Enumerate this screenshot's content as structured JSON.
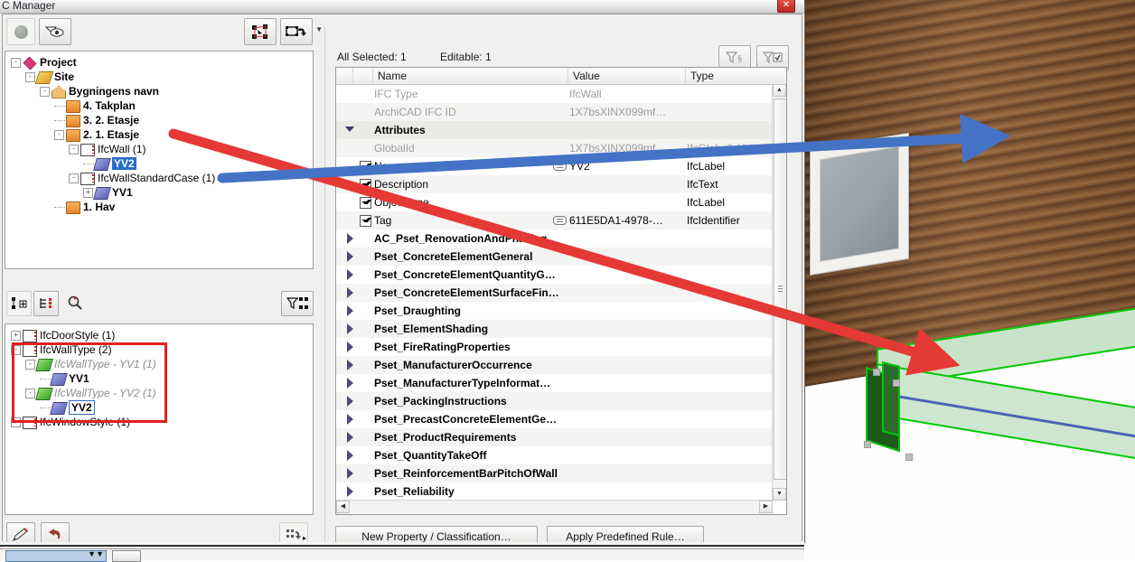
{
  "window": {
    "title": "C Manager",
    "close_label": "✕"
  },
  "viewport": {
    "name": "3d-model-viewport",
    "selected_element_color": "#00c800",
    "wall_material": "wood-cladding",
    "window_count": 1
  },
  "project_tree": {
    "toolbar": {
      "items": [
        {
          "name": "status-indicator",
          "icon": "circle-icon",
          "label": ""
        },
        {
          "name": "show-hide-button",
          "icon": "eye-icon",
          "label": ""
        },
        {
          "name": "select-in-model-button",
          "icon": "select-nodes-icon",
          "label": ""
        },
        {
          "name": "transfer-selection-button",
          "icon": "rect-arrow-icon",
          "label": ""
        }
      ],
      "overflow_label": "▼"
    },
    "rows": [
      {
        "depth": 0,
        "expander": "-",
        "icon": "project-icon",
        "label": "Project",
        "style": "bold"
      },
      {
        "depth": 1,
        "expander": "-",
        "icon": "site-icon",
        "label": "Site",
        "style": "bold"
      },
      {
        "depth": 2,
        "expander": "-",
        "icon": "building-icon",
        "label": "Bygningens navn",
        "style": "bold"
      },
      {
        "depth": 3,
        "expander": "",
        "icon": "story-icon",
        "label": "4. Takplan",
        "style": "bold"
      },
      {
        "depth": 3,
        "expander": "",
        "icon": "story-icon",
        "label": "3. 2. Etasje",
        "style": "bold"
      },
      {
        "depth": 3,
        "expander": "-",
        "icon": "story-icon",
        "label": "2. 1. Etasje",
        "style": "bold"
      },
      {
        "depth": 4,
        "expander": "-",
        "icon": "class-icon",
        "label": "IfcWall (1)",
        "style": "normal"
      },
      {
        "depth": 5,
        "expander": "",
        "icon": "object-blue-icon",
        "label": "YV2",
        "style": "selected"
      },
      {
        "depth": 4,
        "expander": "-",
        "icon": "class-icon",
        "label": "IfcWallStandardCase (1)",
        "style": "normal"
      },
      {
        "depth": 5,
        "expander": "+",
        "icon": "object-blue-icon",
        "label": "YV1",
        "style": "bold"
      },
      {
        "depth": 3,
        "expander": "",
        "icon": "story-icon",
        "label": "1. Hav",
        "style": "bold"
      }
    ]
  },
  "type_tree": {
    "toolbar": {
      "items": [
        {
          "name": "new-type-button",
          "icon": "add-node-icon",
          "label": ""
        },
        {
          "name": "tree-view-button",
          "icon": "tree-list-icon",
          "label": ""
        },
        {
          "name": "search-button",
          "icon": "search-icon",
          "label": ""
        },
        {
          "name": "filter-selection-button",
          "icon": "funnel-nodes-icon",
          "label": ""
        }
      ]
    },
    "rows": [
      {
        "depth": 0,
        "expander": "+",
        "icon": "class-icon",
        "label": "IfcDoorStyle (1)",
        "style": "normal"
      },
      {
        "depth": 0,
        "expander": "-",
        "icon": "class-icon",
        "label": "IfcWallType (2)",
        "style": "normal"
      },
      {
        "depth": 1,
        "expander": "-",
        "icon": "object-green-icon",
        "label": "IfcWallType - YV1 (1)",
        "style": "italic"
      },
      {
        "depth": 2,
        "expander": "",
        "icon": "object-blue-icon",
        "label": "YV1",
        "style": "bold"
      },
      {
        "depth": 1,
        "expander": "-",
        "icon": "object-green-icon",
        "label": "IfcWallType - YV2 (1)",
        "style": "italic"
      },
      {
        "depth": 2,
        "expander": "",
        "icon": "object-blue-icon",
        "label": "YV2",
        "style": "boxed"
      },
      {
        "depth": 0,
        "expander": "+",
        "icon": "class-icon",
        "label": "IfcWindowStyle (1)",
        "style": "normal"
      }
    ],
    "footer": {
      "items": [
        {
          "name": "edit-button",
          "icon": "pencil-icon",
          "label": ""
        },
        {
          "name": "undo-button",
          "icon": "undo-arrow-icon",
          "label": ""
        },
        {
          "name": "options-button",
          "icon": "dots-arrow-icon",
          "label": "▸"
        }
      ]
    }
  },
  "properties": {
    "status_selected": "All Selected: 1",
    "status_editable": "Editable: 1",
    "filter_buttons": [
      {
        "name": "filter-by-paragraph-button",
        "icon": "funnel-paragraph-icon",
        "label": ""
      },
      {
        "name": "filter-by-checked-button",
        "icon": "funnel-check-icon",
        "label": ""
      }
    ],
    "columns": [
      "Name",
      "Value",
      "Type"
    ],
    "rows": [
      {
        "kind": "plain",
        "check": null,
        "name": "IFC Type",
        "value": "IfcWall",
        "type": "",
        "dim": true,
        "link": false
      },
      {
        "kind": "plain",
        "check": null,
        "name": "ArchiCAD IFC ID",
        "value": "1X7bsXINX099mf…",
        "type": "",
        "dim": true,
        "link": false
      },
      {
        "kind": "group",
        "check": null,
        "name": "Attributes",
        "value": "",
        "type": "",
        "dim": false,
        "link": false,
        "expanded": true
      },
      {
        "kind": "plain",
        "check": null,
        "name": "GlobalId",
        "value": "1X7bsXINX099mf…",
        "type": "IfcGloballyUniqueId",
        "dim": true,
        "link": false
      },
      {
        "kind": "checkbox",
        "check": true,
        "name": "Name",
        "value": "YV2",
        "type": "IfcLabel",
        "dim": false,
        "link": true
      },
      {
        "kind": "checkbox",
        "check": true,
        "name": "Description",
        "value": "",
        "type": "IfcText",
        "dim": false,
        "link": false
      },
      {
        "kind": "checkbox",
        "check": true,
        "name": "ObjectType",
        "value": "",
        "type": "IfcLabel",
        "dim": false,
        "link": false
      },
      {
        "kind": "checkbox",
        "check": true,
        "name": "Tag",
        "value": "611E5DA1-4978-…",
        "type": "IfcIdentifier",
        "dim": false,
        "link": true
      },
      {
        "kind": "pset",
        "check": null,
        "name": "AC_Pset_RenovationAndPhasing",
        "value": "",
        "type": "",
        "dim": false,
        "link": false
      },
      {
        "kind": "pset",
        "check": null,
        "name": "Pset_ConcreteElementGeneral",
        "value": "",
        "type": "",
        "dim": false,
        "link": false
      },
      {
        "kind": "pset",
        "check": null,
        "name": "Pset_ConcreteElementQuantityG…",
        "value": "",
        "type": "",
        "dim": false,
        "link": false
      },
      {
        "kind": "pset",
        "check": null,
        "name": "Pset_ConcreteElementSurfaceFin…",
        "value": "",
        "type": "",
        "dim": false,
        "link": false
      },
      {
        "kind": "pset",
        "check": null,
        "name": "Pset_Draughting",
        "value": "",
        "type": "",
        "dim": false,
        "link": false
      },
      {
        "kind": "pset",
        "check": null,
        "name": "Pset_ElementShading",
        "value": "",
        "type": "",
        "dim": false,
        "link": false
      },
      {
        "kind": "pset",
        "check": null,
        "name": "Pset_FireRatingProperties",
        "value": "",
        "type": "",
        "dim": false,
        "link": false
      },
      {
        "kind": "pset",
        "check": null,
        "name": "Pset_ManufacturerOccurrence",
        "value": "",
        "type": "",
        "dim": false,
        "link": false
      },
      {
        "kind": "pset",
        "check": null,
        "name": "Pset_ManufacturerTypeInformat…",
        "value": "",
        "type": "",
        "dim": false,
        "link": false
      },
      {
        "kind": "pset",
        "check": null,
        "name": "Pset_PackingInstructions",
        "value": "",
        "type": "",
        "dim": false,
        "link": false
      },
      {
        "kind": "pset",
        "check": null,
        "name": "Pset_PrecastConcreteElementGe…",
        "value": "",
        "type": "",
        "dim": false,
        "link": false
      },
      {
        "kind": "pset",
        "check": null,
        "name": "Pset_ProductRequirements",
        "value": "",
        "type": "",
        "dim": false,
        "link": false
      },
      {
        "kind": "pset",
        "check": null,
        "name": "Pset_QuantityTakeOff",
        "value": "",
        "type": "",
        "dim": false,
        "link": false
      },
      {
        "kind": "pset",
        "check": null,
        "name": "Pset_ReinforcementBarPitchOfWall",
        "value": "",
        "type": "",
        "dim": false,
        "link": false
      },
      {
        "kind": "pset",
        "check": null,
        "name": "Pset_Reliability",
        "value": "",
        "type": "",
        "dim": false,
        "link": false
      }
    ],
    "buttons": [
      {
        "name": "new-property-classification-button",
        "label": "New Property / Classification…"
      },
      {
        "name": "apply-predefined-rule-button",
        "label": "Apply Predefined Rule…"
      }
    ]
  },
  "annotations": [
    {
      "name": "red-arrow-annotation",
      "color": "#e53935",
      "from": "YV2 in project tree",
      "to": "green highlighted wall in 3D view"
    },
    {
      "name": "blue-arrow-annotation",
      "color": "#4472c4",
      "from": "Name attribute value YV2",
      "to": "wood wall in 3D view"
    },
    {
      "name": "red-highlight-box",
      "color": "#e02020",
      "target": "IfcWallType group in type tree"
    }
  ]
}
